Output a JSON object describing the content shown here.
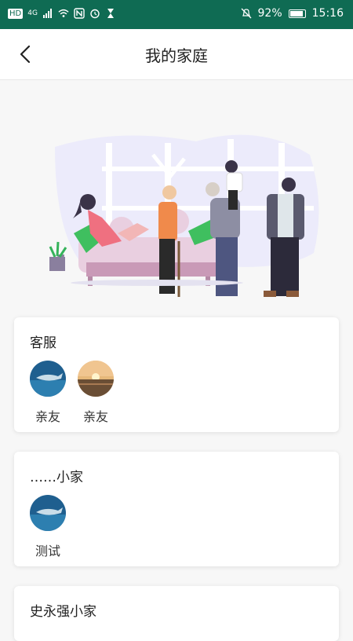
{
  "status_bar": {
    "left_badge": "HD",
    "signal_label": "4G",
    "battery": "92%",
    "battery_level": 0.92,
    "time": "15:16"
  },
  "header": {
    "title": "我的家庭"
  },
  "families": [
    {
      "name": "客服",
      "members": [
        {
          "name": "亲友",
          "avatar": "ocean-shark"
        },
        {
          "name": "亲友",
          "avatar": "sunset-beach"
        }
      ]
    },
    {
      "name": "……小家",
      "members": [
        {
          "name": "测试",
          "avatar": "ocean-shark"
        }
      ]
    },
    {
      "name": "史永强小家",
      "members": []
    }
  ],
  "colors": {
    "status_bar_bg": "#0f6b53",
    "page_bg": "#f7f7f7",
    "card_bg": "#ffffff"
  }
}
